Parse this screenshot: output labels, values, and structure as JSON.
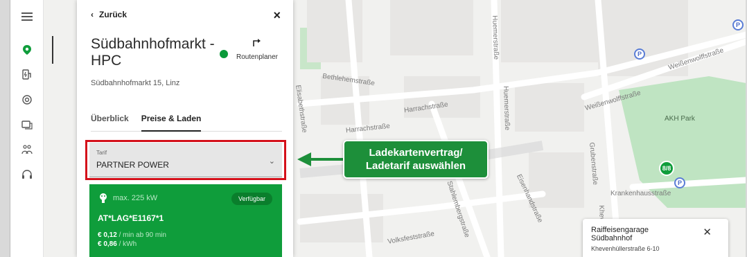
{
  "rail": {
    "icons": [
      "menu-icon",
      "location-pin-icon",
      "charging-station-icon",
      "target-icon",
      "card-icon",
      "people-icon",
      "headset-icon"
    ]
  },
  "panel": {
    "back_label": "Zurück",
    "close_label": "×",
    "title": "Südbahnhofmarkt - HPC",
    "route_label": "Routenplaner",
    "address": "Südbahnhofmarkt 15, Linz",
    "tabs": [
      {
        "label": "Überblick",
        "active": false
      },
      {
        "label": "Preise & Laden",
        "active": true
      }
    ],
    "tarif": {
      "small_label": "Tarif",
      "value": "PARTNER POWER"
    },
    "connector": {
      "power": "max. 225 kW",
      "status": "Verfügbar",
      "id": "AT*LAG*E1167*1",
      "price_time": "€ 0,12",
      "price_time_unit": "/ min ab 90 min",
      "price_energy": "€ 0,86",
      "price_energy_unit": "/ kWh"
    }
  },
  "callout": {
    "line1": "Ladekartenvertrag/",
    "line2": "Ladetarif auswählen"
  },
  "map": {
    "streets": [
      "Bethlehemstraße",
      "Elisabethstraße",
      "Harrachstraße",
      "Harrachstraße",
      "Huemerstraße",
      "Huemerstraße",
      "Weißenwolffstraße",
      "Weißenwolffstraße",
      "Grubenstraße",
      "Eisenhandstraße",
      "Krankenhausstraße",
      "Volksfeststraße",
      "Stahlembergstraße",
      "AKH Park",
      "Khev"
    ],
    "cluster_label": "8/8",
    "parking_label": "P",
    "info_card": {
      "title_line1": "Raiffeisengarage",
      "title_line2": "Südbahnhof",
      "address": "Khevenhüllerstraße 6-10"
    }
  },
  "colors": {
    "brand_green": "#0f9d3b",
    "highlight_red": "#d4101a",
    "callout_green": "#1d8f3a"
  }
}
